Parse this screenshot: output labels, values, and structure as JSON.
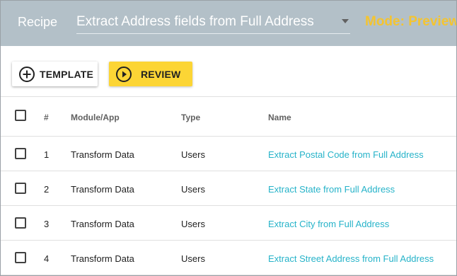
{
  "header": {
    "recipe_label": "Recipe",
    "recipe_value": "Extract Address fields from Full Address",
    "mode_text": "Mode: Preview"
  },
  "toolbar": {
    "template_label": "TEMPLATE",
    "review_label": "REVIEW"
  },
  "colors": {
    "header_bg": "#b3c0c8",
    "mode_text": "#f4c430",
    "review_button": "#fcd535",
    "link": "#26b3c9"
  },
  "table": {
    "columns": [
      "#",
      "Module/App",
      "Type",
      "Name"
    ],
    "rows": [
      {
        "num": "1",
        "module": "Transform Data",
        "type": "Users",
        "name": "Extract Postal Code from Full Address"
      },
      {
        "num": "2",
        "module": "Transform Data",
        "type": "Users",
        "name": "Extract State from Full Address"
      },
      {
        "num": "3",
        "module": "Transform Data",
        "type": "Users",
        "name": "Extract City from Full Address"
      },
      {
        "num": "4",
        "module": "Transform Data",
        "type": "Users",
        "name": "Extract Street Address from Full Address"
      }
    ]
  },
  "icons": {
    "template": "add-circle-icon",
    "review": "play-circle-icon",
    "recipe_dropdown": "caret-down-icon"
  }
}
